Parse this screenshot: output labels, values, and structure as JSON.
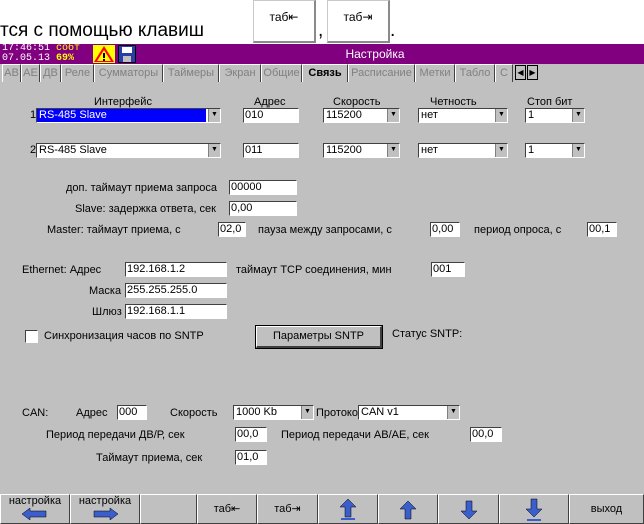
{
  "doc": {
    "text": "тся с помощью клавиш",
    "key1": "таб⇤",
    "key2": "таб⇥",
    "comma": ",",
    "period": "."
  },
  "status": {
    "time": "17:46:51",
    "label": "собт",
    "date": "07.05.13",
    "battery": "69%"
  },
  "window_title": "Настройка",
  "tabs": [
    {
      "label": "АВ"
    },
    {
      "label": "АЕ"
    },
    {
      "label": "ДВ"
    },
    {
      "label": "Реле"
    },
    {
      "label": "Сумматоры"
    },
    {
      "label": "Таймеры"
    },
    {
      "label": "Экран"
    },
    {
      "label": "Общие"
    },
    {
      "label": "Связь"
    },
    {
      "label": "Расписание"
    },
    {
      "label": "Метки"
    },
    {
      "label": "Табло"
    },
    {
      "label": "С"
    }
  ],
  "headers": {
    "interface": "Интерфейс",
    "address": "Адрес",
    "speed": "Скорость",
    "parity": "Четность",
    "stop": "Стоп бит"
  },
  "rows": [
    {
      "num": "1",
      "interface": "RS-485 Slave",
      "address": "010",
      "speed": "115200",
      "parity": "нет",
      "stop": "1"
    },
    {
      "num": "2",
      "interface": "RS-485 Slave",
      "address": "011",
      "speed": "115200",
      "parity": "нет",
      "stop": "1"
    }
  ],
  "extra_timeout": {
    "label": "доп. таймаут приема запроса",
    "value": "00000"
  },
  "slave_delay": {
    "label": "Slave: задержка ответа, сек",
    "value": "0,00"
  },
  "master": {
    "timeout_label": "Master: таймаут приема, с",
    "timeout_value": "02,0",
    "pause_label": "пауза между запросами, с",
    "pause_value": "0,00",
    "period_label": "период опроса, с",
    "period_value": "00,1"
  },
  "ethernet": {
    "address_label": "Ethernet: Адрес",
    "address": "192.168.1.2",
    "tcp_label": "таймаут TCP соединения, мин",
    "tcp_value": "001",
    "mask_label": "Маска",
    "mask": "255.255.255.0",
    "gateway_label": "Шлюз",
    "gateway": "192.168.1.1"
  },
  "sntp": {
    "sync_label": "Синхронизация часов по SNTP",
    "button": "Параметры SNTP",
    "status": "Статус SNTP:"
  },
  "can": {
    "label": "CAN:",
    "address_label": "Адрес",
    "address": "000",
    "speed_label": "Скорость",
    "speed": "1000 Kb",
    "protocol_label": "Протокол",
    "protocol": "CAN v1",
    "period_dvr_label": "Период передачи ДВ/Р, сек",
    "period_dvr": "00,0",
    "period_ab_label": "Период передачи АВ/АЕ, сек",
    "period_ab": "00,0",
    "timeout_label": "Таймаут приема, сек",
    "timeout": "01,0"
  },
  "toolbar": {
    "left1": "настройка",
    "left2": "настройка",
    "tab_back": "таб⇤",
    "tab_fwd": "таб⇥",
    "exit": "выход"
  },
  "colors": {
    "titlebar": "#800080",
    "face": "#c0c0c0",
    "selection": "#0000ff",
    "arrow": "#3a5fcd"
  }
}
